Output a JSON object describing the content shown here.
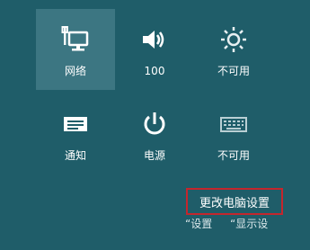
{
  "colors": {
    "background": "#1f5d69",
    "active_tile": "#3c7682",
    "highlight_border": "#c4262d",
    "text": "#ffffff"
  },
  "tiles": [
    {
      "label": "网络",
      "icon": "network-icon",
      "active": true
    },
    {
      "label": "100",
      "icon": "volume-icon",
      "active": false
    },
    {
      "label": "不可用",
      "icon": "brightness-icon",
      "active": false
    },
    {
      "label": "通知",
      "icon": "notifications-icon",
      "active": false
    },
    {
      "label": "电源",
      "icon": "power-icon",
      "active": false
    },
    {
      "label": "不可用",
      "icon": "keyboard-icon",
      "active": false
    }
  ],
  "footer": {
    "change_pc_settings": "更改电脑设置",
    "cut_left": "“设置",
    "cut_right": "“显示设"
  }
}
